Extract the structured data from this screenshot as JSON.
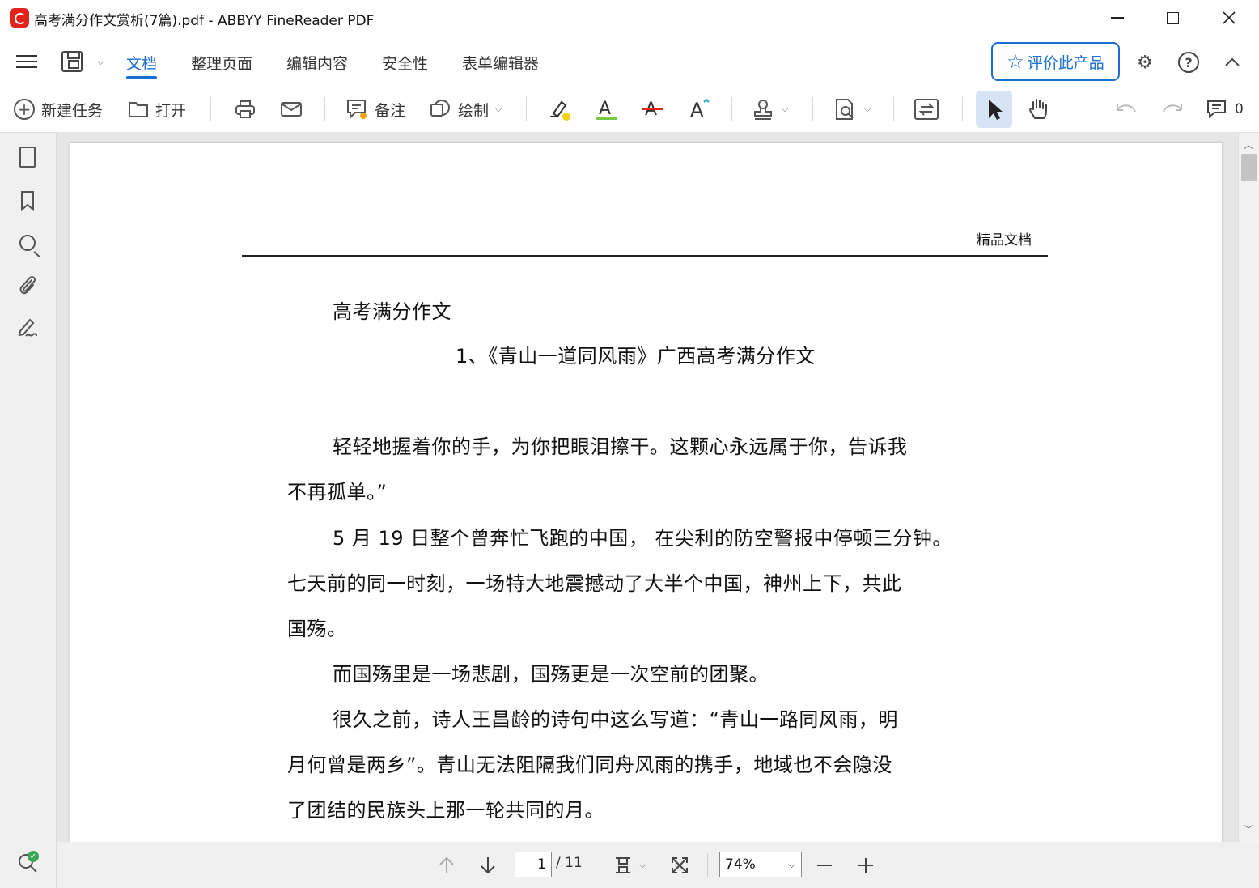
{
  "window": {
    "title": "高考满分作文赏析(7篇).pdf - ABBYY FineReader PDF"
  },
  "menu": {
    "tabs": [
      "文档",
      "整理页面",
      "编辑内容",
      "安全性",
      "表单编辑器"
    ],
    "active_tab": "文档",
    "rate_button": "评价此产品"
  },
  "toolbar": {
    "new_task": "新建任务",
    "open": "打开",
    "note": "备注",
    "draw": "绘制",
    "comments_count": "0"
  },
  "document": {
    "header_right": "精品文档",
    "lines": [
      "高考满分作文",
      "1、《青山一道同风雨》广西高考满分作文",
      "轻轻地握着你的手，为你把眼泪擦干。这颗心永远属于你，告诉我",
      "不再孤单。”",
      "5 月 19 日整个曾奔忙飞跑的中国，  在尖利的防空警报中停顿三分钟。",
      "七天前的同一时刻，一场特大地震撼动了大半个中国，神州上下，共此",
      "国殇。",
      "而国殇里是一场悲剧，国殇更是一次空前的团聚。",
      "很久之前，诗人王昌龄的诗句中这么写道：“青山一路同风雨，明",
      "月何曾是两乡”。青山无法阻隔我们同舟风雨的携手，地域也不会隐没",
      "了团结的民族头上那一轮共同的月。"
    ]
  },
  "navigation": {
    "current_page": "1",
    "total_pages": "/ 11",
    "zoom": "74%"
  },
  "colors": {
    "accent": "#1a6fd1",
    "brand_red": "#e2231a",
    "select_highlight": "#d6e4f6"
  }
}
